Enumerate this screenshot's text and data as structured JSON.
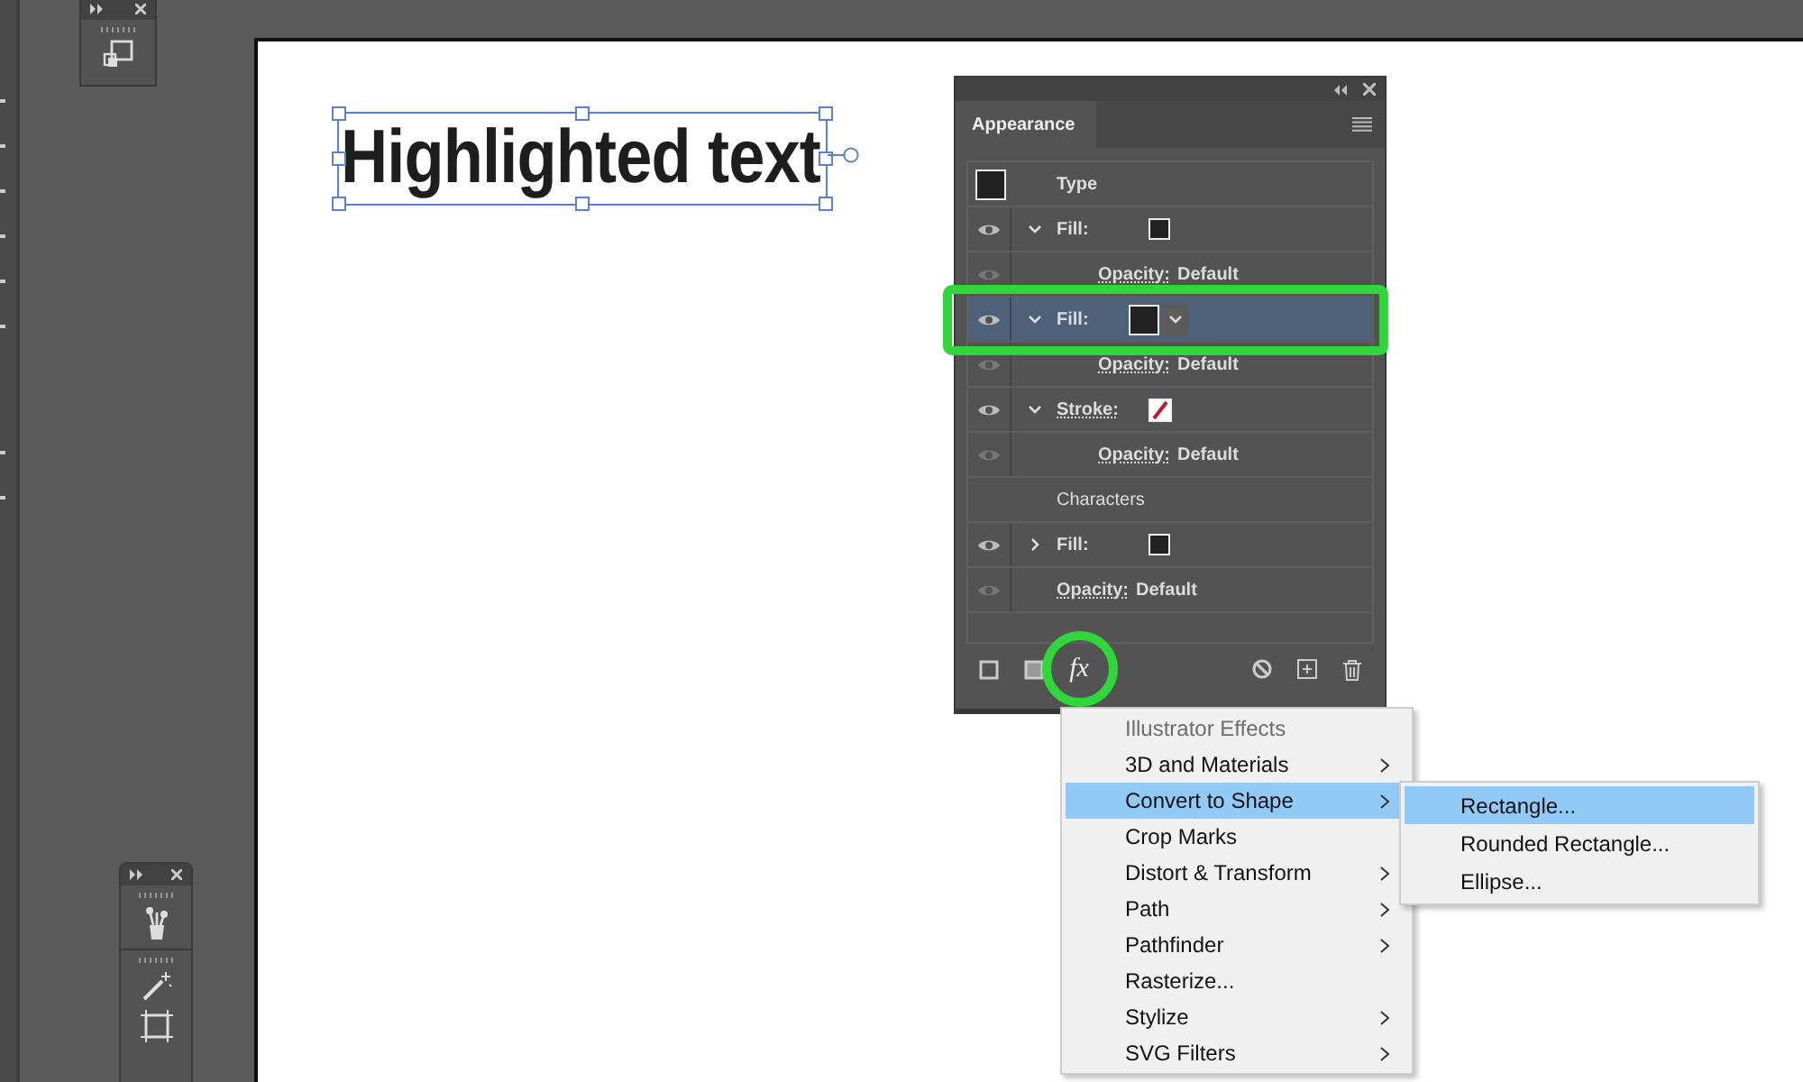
{
  "artboard": {
    "text": "Highlighted text",
    "selected": true
  },
  "appearance_panel": {
    "tab": "Appearance",
    "sections": [
      {
        "title": "Type",
        "kind": "header",
        "swatch": {
          "kind": "solid",
          "color": "#222222"
        },
        "items": [
          {
            "kind": "fill",
            "label": "Fill:",
            "swatch": {
              "kind": "solid",
              "color": "#222222"
            },
            "expanded": true,
            "selected": false,
            "children": [
              {
                "kind": "opacity",
                "label": "Opacity:",
                "value": "Default"
              }
            ]
          },
          {
            "kind": "fill",
            "label": "Fill:",
            "swatch": {
              "kind": "solid",
              "color": "#222222"
            },
            "expanded": true,
            "selected": true,
            "children": [
              {
                "kind": "opacity",
                "label": "Opacity:",
                "value": "Default"
              }
            ]
          },
          {
            "kind": "stroke",
            "label": "Stroke:",
            "swatch": {
              "kind": "none"
            },
            "expanded": true,
            "selected": false,
            "children": [
              {
                "kind": "opacity",
                "label": "Opacity:",
                "value": "Default"
              }
            ]
          }
        ]
      },
      {
        "title": "Characters",
        "kind": "plain",
        "items": [
          {
            "kind": "fill",
            "label": "Fill:",
            "swatch": {
              "kind": "solid",
              "color": "#222222"
            },
            "expanded": false,
            "selected": false
          },
          {
            "kind": "opacity",
            "label": "Opacity:",
            "value": "Default"
          }
        ]
      }
    ],
    "toolbar": [
      {
        "kind": "new-stroke"
      },
      {
        "kind": "new-fill"
      },
      {
        "kind": "fx",
        "label": "fx",
        "highlighted": true
      },
      {
        "kind": "clear"
      },
      {
        "kind": "duplicate"
      },
      {
        "kind": "delete"
      }
    ]
  },
  "effects_menu": {
    "items": [
      {
        "label": "Illustrator Effects",
        "disabled": true,
        "submenu": false,
        "selected": false
      },
      {
        "label": "3D and Materials",
        "disabled": false,
        "submenu": true,
        "selected": false
      },
      {
        "label": "Convert to Shape",
        "disabled": false,
        "submenu": true,
        "selected": true
      },
      {
        "label": "Crop Marks",
        "disabled": false,
        "submenu": false,
        "selected": false
      },
      {
        "label": "Distort & Transform",
        "disabled": false,
        "submenu": true,
        "selected": false
      },
      {
        "label": "Path",
        "disabled": false,
        "submenu": true,
        "selected": false
      },
      {
        "label": "Pathfinder",
        "disabled": false,
        "submenu": true,
        "selected": false
      },
      {
        "label": "Rasterize...",
        "disabled": false,
        "submenu": false,
        "selected": false
      },
      {
        "label": "Stylize",
        "disabled": false,
        "submenu": true,
        "selected": false
      },
      {
        "label": "SVG Filters",
        "disabled": false,
        "submenu": true,
        "selected": false
      }
    ],
    "submenu": [
      {
        "label": "Rectangle...",
        "selected": true
      },
      {
        "label": "Rounded Rectangle...",
        "selected": false
      },
      {
        "label": "Ellipse...",
        "selected": false
      }
    ]
  }
}
